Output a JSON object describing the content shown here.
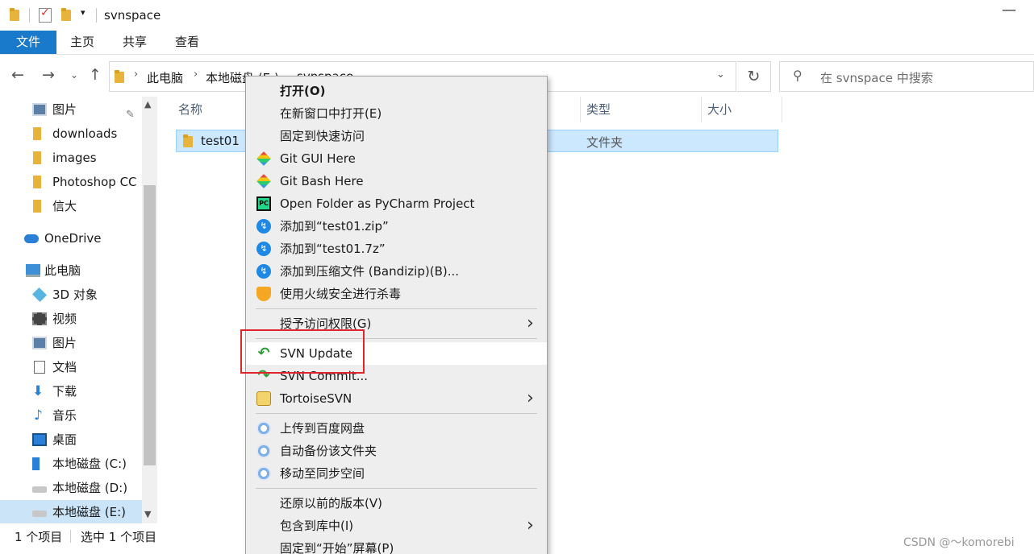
{
  "window": {
    "title": "svnspace",
    "minimize_glyph": "—"
  },
  "ribbon": {
    "tabs": [
      "文件",
      "主页",
      "共享",
      "查看"
    ]
  },
  "address": {
    "crumbs": [
      "此电脑",
      "本地磁盘 (E:)",
      "svnspace"
    ],
    "search_placeholder": "在 svnspace 中搜索"
  },
  "nav": {
    "items": [
      {
        "label": "图片",
        "icon": "picture-icon",
        "pinned": true
      },
      {
        "label": "downloads",
        "icon": "folder-icon"
      },
      {
        "label": "images",
        "icon": "folder-icon"
      },
      {
        "label": "Photoshop CC",
        "icon": "folder-icon"
      },
      {
        "label": "信大",
        "icon": "folder-icon"
      },
      {
        "label": "OneDrive",
        "icon": "onedrive-icon"
      },
      {
        "label": "此电脑",
        "icon": "this-pc-icon"
      },
      {
        "label": "3D 对象",
        "icon": "3d-objects-icon"
      },
      {
        "label": "视频",
        "icon": "video-icon"
      },
      {
        "label": "图片",
        "icon": "picture-icon"
      },
      {
        "label": "文档",
        "icon": "document-icon"
      },
      {
        "label": "下载",
        "icon": "download-icon"
      },
      {
        "label": "音乐",
        "icon": "music-icon"
      },
      {
        "label": "桌面",
        "icon": "desktop-icon"
      },
      {
        "label": "本地磁盘 (C:)",
        "icon": "windows-drive-icon"
      },
      {
        "label": "本地磁盘 (D:)",
        "icon": "drive-icon"
      },
      {
        "label": "本地磁盘 (E:)",
        "icon": "drive-icon",
        "selected": true
      }
    ]
  },
  "filelist": {
    "columns": {
      "name": "名称",
      "type": "类型",
      "size": "大小"
    },
    "rows": [
      {
        "name": "test01",
        "type": "文件夹"
      }
    ]
  },
  "status": {
    "count": "1 个项目",
    "selected": "选中 1 个项目"
  },
  "watermark": "CSDN @～komorebi",
  "context_menu": {
    "items": [
      {
        "label": "打开(O)",
        "bold": true
      },
      {
        "label": "在新窗口中打开(E)"
      },
      {
        "label": "固定到快速访问"
      },
      {
        "label": "Git GUI Here",
        "icon": "git-gui-icon"
      },
      {
        "label": "Git Bash Here",
        "icon": "git-bash-icon"
      },
      {
        "label": "Open Folder as PyCharm Project",
        "icon": "pycharm-icon"
      },
      {
        "label": "添加到“test01.zip”",
        "icon": "bandizip-icon"
      },
      {
        "label": "添加到“test01.7z”",
        "icon": "bandizip-icon"
      },
      {
        "label": "添加到压缩文件 (Bandizip)(B)...",
        "icon": "bandizip-icon"
      },
      {
        "label": "使用火绒安全进行杀毒",
        "icon": "huorong-icon"
      },
      {
        "label": "授予访问权限(G)",
        "submenu": true
      },
      {
        "label": "SVN Update",
        "icon": "svn-update-icon",
        "highlighted": true
      },
      {
        "label": "SVN Commit...",
        "icon": "svn-commit-icon"
      },
      {
        "label": "TortoiseSVN",
        "icon": "tortoisesvn-icon",
        "submenu": true
      },
      {
        "label": "上传到百度网盘",
        "icon": "baidu-netdisk-icon"
      },
      {
        "label": "自动备份该文件夹",
        "icon": "baidu-netdisk-icon"
      },
      {
        "label": "移动至同步空间",
        "icon": "baidu-netdisk-icon"
      },
      {
        "label": "还原以前的版本(V)"
      },
      {
        "label": "包含到库中(I)",
        "submenu": true
      },
      {
        "label": "固定到“开始”屏幕(P)"
      }
    ],
    "highlight_color": "#e0262b"
  }
}
